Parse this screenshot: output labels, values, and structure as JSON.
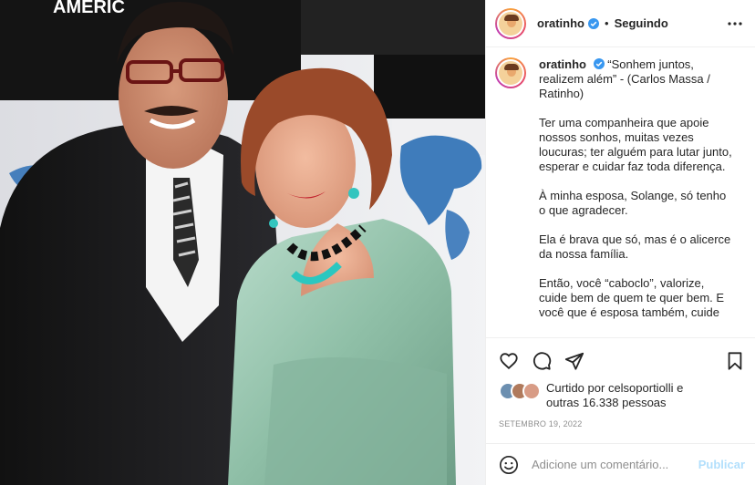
{
  "post": {
    "author": {
      "username": "oratinho",
      "verified": true
    },
    "header": {
      "separator": "•",
      "follow_status": "Seguindo",
      "more_icon": "more-horizontal-icon"
    },
    "caption": {
      "username": "oratinho",
      "paragraphs": [
        "“Sonhem juntos, realizem além” - (Carlos Massa / Ratinho)",
        "Ter uma companheira que apoie nossos sonhos, muitas vezes loucuras; ter alguém para lutar junto, esperar e cuidar faz toda diferença.",
        "À minha esposa, Solange, só tenho o que agradecer.",
        "Ela é brava que só, mas é o alicerce da nossa família.",
        "Então, você “caboclo”, valorize, cuide bem de quem te quer bem. E você que é esposa também, cuide"
      ]
    },
    "photo": {
      "banner_text": "AMERIC"
    },
    "actions": [
      "heart-icon",
      "comment-icon",
      "share-icon",
      "bookmark-icon"
    ],
    "likes": {
      "prefix": "Curtido por",
      "user": "celsoportiolli",
      "conjunction": "e",
      "others": "outras 16.338 pessoas"
    },
    "date": "SETEMBRO 19, 2022",
    "comment": {
      "placeholder": "Adicione um comentário...",
      "publish_label": "Publicar"
    },
    "colors": {
      "verified_blue": "#3897f0",
      "publish_disabled": "#b2dffc",
      "muted_text": "#8e8e8e",
      "dress_green": "#9dc7b2",
      "suit_black": "#1c1c1e"
    }
  }
}
